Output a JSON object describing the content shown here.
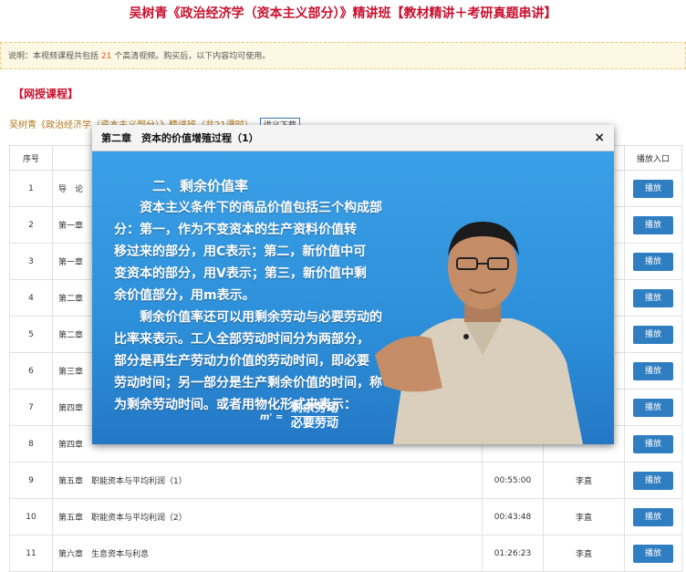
{
  "header": {
    "title": "吴树青《政治经济学（资本主义部分）》精讲班【教材精讲＋考研真题串讲】"
  },
  "notice": {
    "prefix": "说明：本视频课程共包括",
    "count": "21",
    "suffix": "个高清视频。购买后，以下内容均可使用。"
  },
  "section": {
    "title": "【网授课程】"
  },
  "course": {
    "name": "吴树青《政治经济学（资本主义部分）》精讲班（共21课时）",
    "download": "讲义下载"
  },
  "table": {
    "headers": [
      "序号",
      "",
      "",
      "",
      "播放入口"
    ],
    "play_label": "播放",
    "rows": [
      {
        "no": "1",
        "title": "导　论",
        "duration": "",
        "teacher": ""
      },
      {
        "no": "2",
        "title": "第一章",
        "duration": "",
        "teacher": ""
      },
      {
        "no": "3",
        "title": "第一章",
        "duration": "",
        "teacher": ""
      },
      {
        "no": "4",
        "title": "第二章",
        "duration": "",
        "teacher": ""
      },
      {
        "no": "5",
        "title": "第二章",
        "duration": "",
        "teacher": ""
      },
      {
        "no": "6",
        "title": "第三章",
        "duration": "",
        "teacher": ""
      },
      {
        "no": "7",
        "title": "第四章",
        "duration": "",
        "teacher": ""
      },
      {
        "no": "8",
        "title": "第四章",
        "duration": "",
        "teacher": ""
      },
      {
        "no": "9",
        "title": "第五章　职能资本与平均利润（1）",
        "duration": "00:55:00",
        "teacher": "李直"
      },
      {
        "no": "10",
        "title": "第五章　职能资本与平均利润（2）",
        "duration": "00:43:48",
        "teacher": "李直"
      },
      {
        "no": "11",
        "title": "第六章　生息资本与利息",
        "duration": "01:26:23",
        "teacher": "李直"
      }
    ]
  },
  "modal": {
    "title": "第二章　资本的价值增殖过程（1）",
    "close": "×",
    "slide_lines": [
      "二、剩余价值率",
      "资本主义条件下的商品价值包括三个构成部",
      "分：第一，作为不变资本的生产资料价值转",
      "移过来的部分，用C表示；第二，新价值中可",
      "变资本的部分，用V表示；第三，新价值中剩",
      "余价值部分，用m表示。",
      "剩余价值率还可以用剩余劳动与必要劳动的",
      "比率来表示。工人全部劳动时间分为两部分，",
      "部分是再生产劳动力价值的劳动时间，即必要",
      "劳动时间；另一部分是生产剩余价值的时间，称",
      "为剩余劳动时间。或者用物化形式来表示："
    ],
    "formula_m": "m' =",
    "formula_num": "剩余劳动",
    "formula_den": "必要劳动"
  },
  "colors": {
    "title_red": "#c8102e",
    "play_blue": "#2f7ec2",
    "slide_blue": "#2d8fd9"
  }
}
